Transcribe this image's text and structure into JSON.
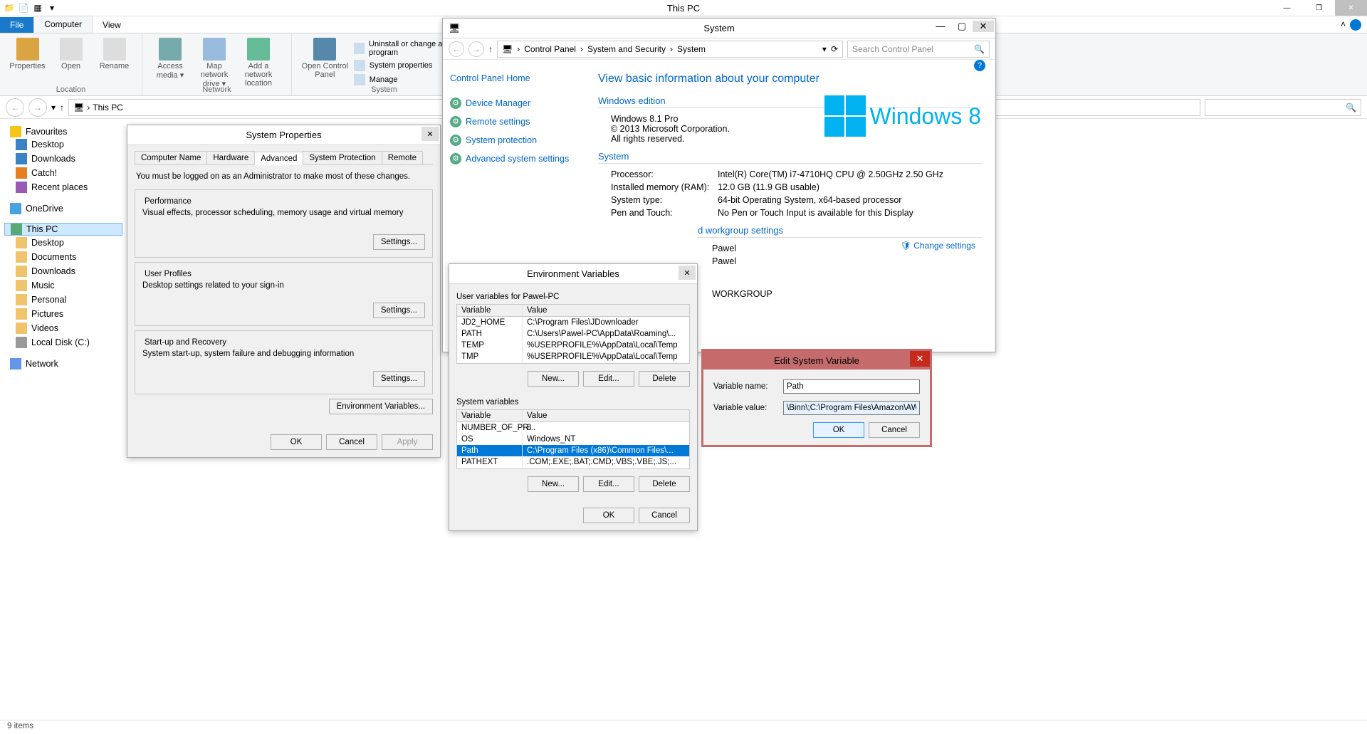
{
  "titlebar": {
    "title": "This PC"
  },
  "win_controls": {
    "min": "—",
    "max": "❐",
    "close": "✕"
  },
  "ribbon_tabs": {
    "file": "File",
    "computer": "Computer",
    "view": "View"
  },
  "ribbon": {
    "location": {
      "properties": "Properties",
      "open": "Open",
      "rename": "Rename",
      "group": "Location"
    },
    "network": {
      "access": "Access media ▾",
      "map": "Map network drive ▾",
      "add": "Add a network location",
      "group": "Network"
    },
    "system": {
      "opencp": "Open Control Panel",
      "uninstall": "Uninstall or change a program",
      "sysprop": "System properties",
      "manage": "Manage",
      "group": "System"
    }
  },
  "addr": {
    "path": "This PC"
  },
  "navtree": {
    "fav": "Favourites",
    "fav_items": [
      "Desktop",
      "Downloads",
      "Catch!",
      "Recent places"
    ],
    "onedrive": "OneDrive",
    "thispc": "This PC",
    "pc_items": [
      "Desktop",
      "Documents",
      "Downloads",
      "Music",
      "Personal",
      "Pictures",
      "Videos",
      "Local Disk (C:)"
    ],
    "network": "Network"
  },
  "sysprops": {
    "title": "System Properties",
    "tabs": [
      "Computer Name",
      "Hardware",
      "Advanced",
      "System Protection",
      "Remote"
    ],
    "admin_note": "You must be logged on as an Administrator to make most of these changes.",
    "perf": {
      "legend": "Performance",
      "desc": "Visual effects, processor scheduling, memory usage and virtual memory",
      "btn": "Settings..."
    },
    "prof": {
      "legend": "User Profiles",
      "desc": "Desktop settings related to your sign-in",
      "btn": "Settings..."
    },
    "startup": {
      "legend": "Start-up and Recovery",
      "desc": "System start-up, system failure and debugging information",
      "btn": "Settings..."
    },
    "envbtn": "Environment Variables...",
    "ok": "OK",
    "cancel": "Cancel",
    "apply": "Apply"
  },
  "system": {
    "title": "System",
    "breadcrumb": [
      "Control Panel",
      "System and Security",
      "System"
    ],
    "search_ph": "Search Control Panel",
    "cphome": "Control Panel Home",
    "left_links": [
      "Device Manager",
      "Remote settings",
      "System protection",
      "Advanced system settings"
    ],
    "h2": "View basic information about your computer",
    "edition_hdr": "Windows edition",
    "edition": "Windows 8.1 Pro",
    "copy": "© 2013 Microsoft Corporation. All rights reserved.",
    "logo_txt": "Windows 8",
    "sys_hdr": "System",
    "proc_k": "Processor:",
    "proc_v": "Intel(R) Core(TM) i7-4710HQ CPU @ 2.50GHz   2.50 GHz",
    "ram_k": "Installed memory (RAM):",
    "ram_v": "12.0 GB (11.9 GB usable)",
    "type_k": "System type:",
    "type_v": "64-bit Operating System, x64-based processor",
    "pen_k": "Pen and Touch:",
    "pen_v": "No Pen or Touch Input is available for this Display",
    "wkgrp_hdr": "d workgroup settings",
    "name1": "Pawel",
    "name2": "Pawel",
    "change": "Change settings",
    "wkgrp": "WORKGROUP"
  },
  "envvars": {
    "title": "Environment Variables",
    "user_legend": "User variables for Pawel-PC",
    "hdr_var": "Variable",
    "hdr_val": "Value",
    "user_rows": [
      {
        "v": "JD2_HOME",
        "val": "C:\\Program Files\\JDownloader"
      },
      {
        "v": "PATH",
        "val": "C:\\Users\\Pawel-PC\\AppData\\Roaming\\..."
      },
      {
        "v": "TEMP",
        "val": "%USERPROFILE%\\AppData\\Local\\Temp"
      },
      {
        "v": "TMP",
        "val": "%USERPROFILE%\\AppData\\Local\\Temp"
      }
    ],
    "sys_legend": "System variables",
    "sys_rows": [
      {
        "v": "NUMBER_OF_PR...",
        "val": "8"
      },
      {
        "v": "OS",
        "val": "Windows_NT"
      },
      {
        "v": "Path",
        "val": "C:\\Program Files (x86)\\Common Files\\...",
        "sel": true
      },
      {
        "v": "PATHEXT",
        "val": ".COM;.EXE;.BAT;.CMD;.VBS;.VBE;.JS;..."
      }
    ],
    "new": "New...",
    "edit": "Edit...",
    "del": "Delete",
    "ok": "OK",
    "cancel": "Cancel"
  },
  "editvar": {
    "title": "Edit System Variable",
    "name_lbl": "Variable name:",
    "name_val": "Path",
    "val_lbl": "Variable value:",
    "val_val": "\\Binn\\;C:\\Program Files\\Amazon\\AWSCLI\\",
    "ok": "OK",
    "cancel": "Cancel"
  },
  "status": "9 items"
}
